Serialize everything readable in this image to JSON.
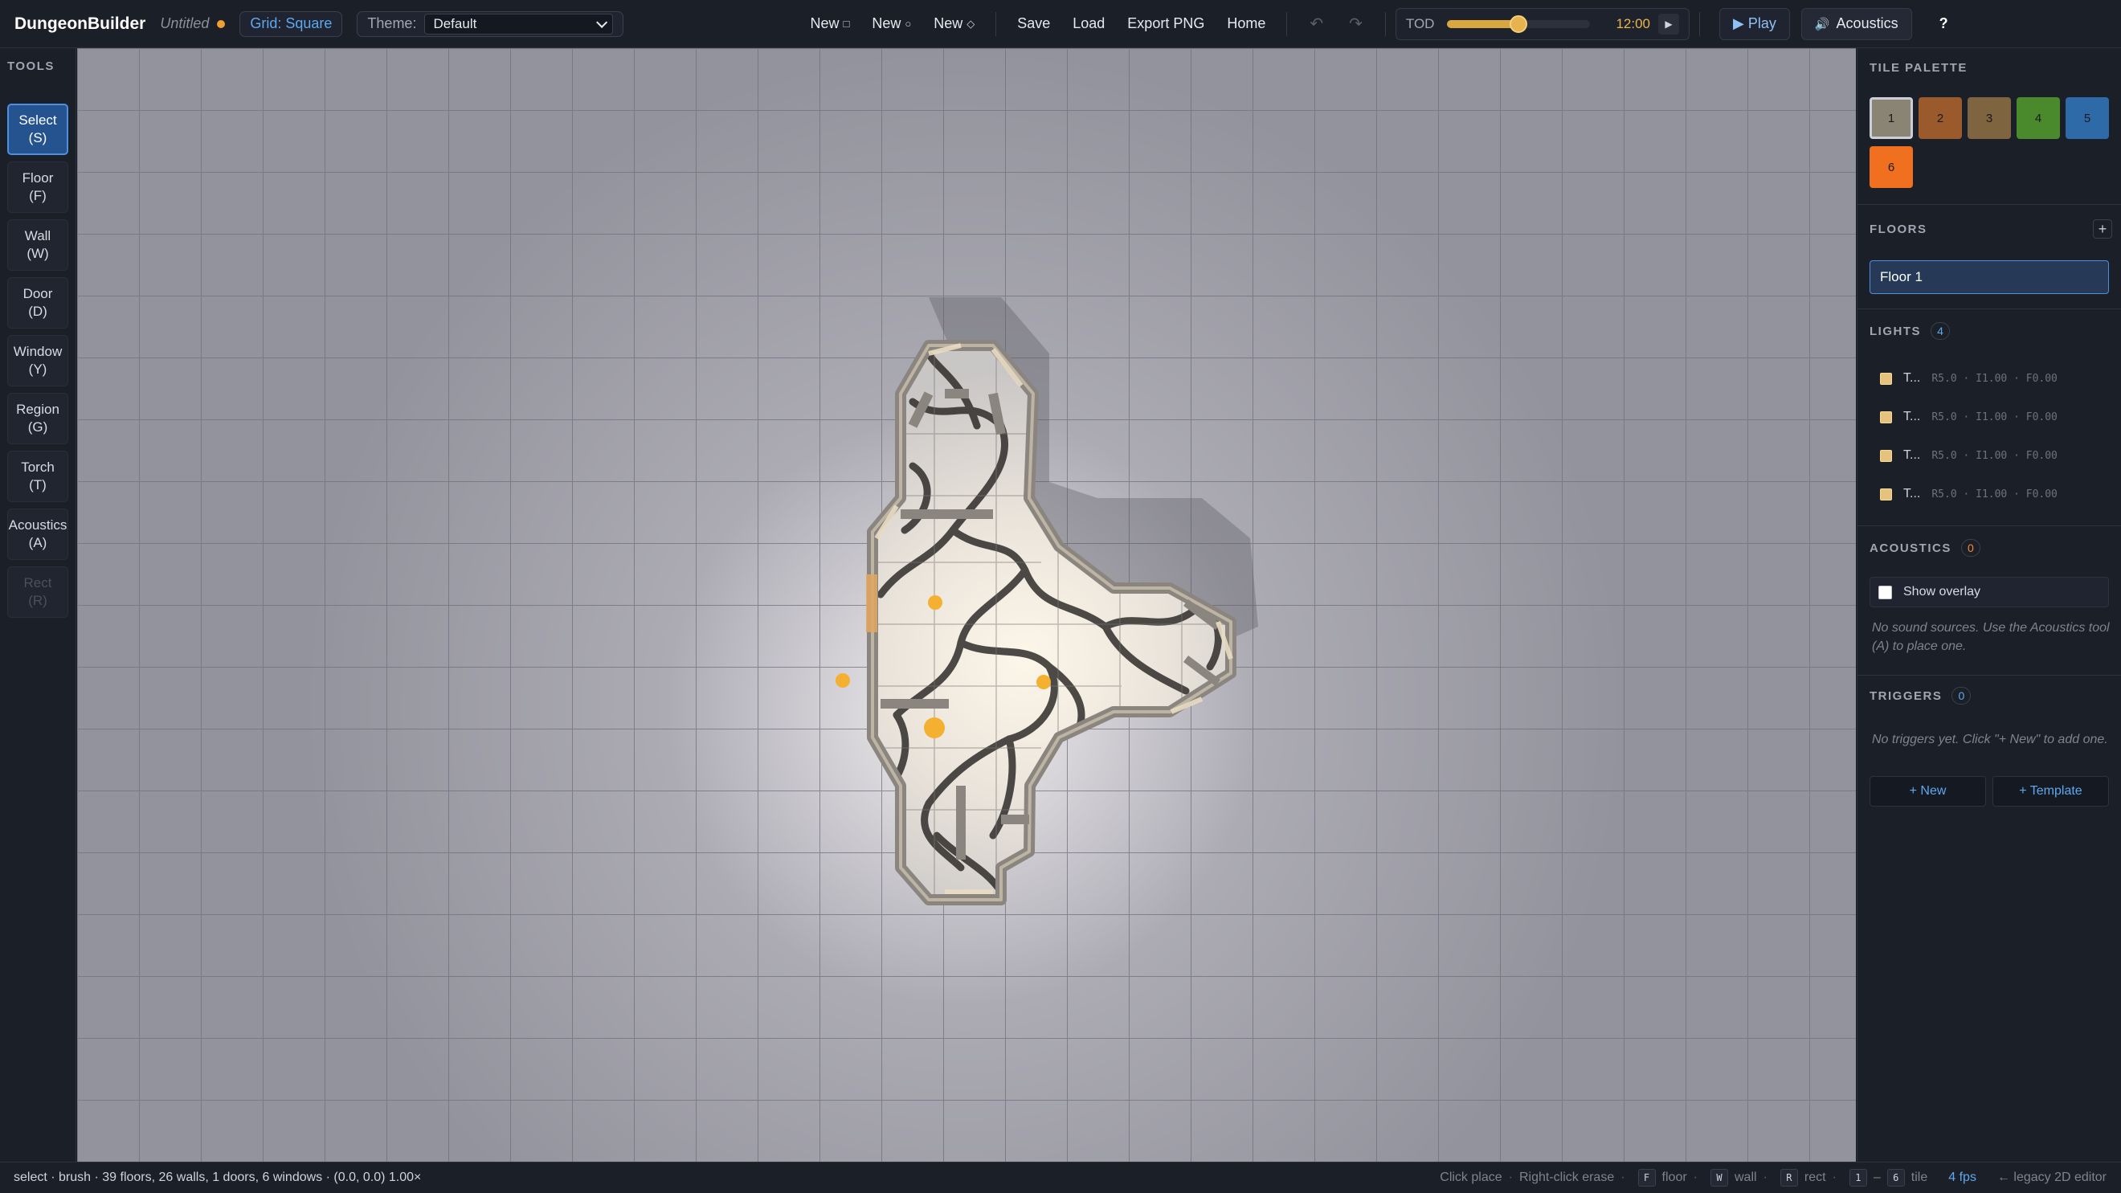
{
  "app": {
    "brand": "DungeonBuilder",
    "doc_name": "Untitled",
    "grid_label": "Grid: Square",
    "theme_label": "Theme:",
    "theme_value": "Default"
  },
  "toolbar": {
    "new_square": "New",
    "new_square_glyph": "□",
    "new_circle": "New",
    "new_circle_glyph": "○",
    "new_diamond": "New",
    "new_diamond_glyph": "◇",
    "save": "Save",
    "load": "Load",
    "export": "Export PNG",
    "home": "Home",
    "undo_glyph": "↶",
    "redo_glyph": "↷",
    "tod_label": "TOD",
    "tod_value": 0.5,
    "tod_time": "12:00",
    "tod_play_glyph": "▶",
    "play": "▶ Play",
    "acoustics_glyph": "🔊",
    "acoustics": "Acoustics",
    "help": "?"
  },
  "tools": {
    "title": "TOOLS",
    "items": [
      {
        "label": "Select",
        "key": "(S)"
      },
      {
        "label": "Floor",
        "key": "(F)"
      },
      {
        "label": "Wall",
        "key": "(W)"
      },
      {
        "label": "Door",
        "key": "(D)"
      },
      {
        "label": "Window",
        "key": "(Y)"
      },
      {
        "label": "Region",
        "key": "(G)"
      },
      {
        "label": "Torch",
        "key": "(T)"
      },
      {
        "label": "Acoustics",
        "key": "(A)"
      },
      {
        "label": "Rect",
        "key": "(R)"
      }
    ]
  },
  "panel": {
    "tile_palette": {
      "title": "TILE PALETTE",
      "swatches": [
        {
          "label": "1",
          "color": "#8a8475"
        },
        {
          "label": "2",
          "color": "#9a5a2c"
        },
        {
          "label": "3",
          "color": "#7f6440"
        },
        {
          "label": "4",
          "color": "#4a8a2c"
        },
        {
          "label": "5",
          "color": "#2e6aa8"
        },
        {
          "label": "6",
          "color": "#f07020"
        }
      ]
    },
    "floors": {
      "title": "FLOORS",
      "add": "+",
      "items": [
        "Floor 1"
      ]
    },
    "lights": {
      "title": "LIGHTS",
      "count": "4",
      "items": [
        {
          "name": "T...",
          "meta": "R5.0 · I1.00 · F0.00"
        },
        {
          "name": "T...",
          "meta": "R5.0 · I1.00 · F0.00"
        },
        {
          "name": "T...",
          "meta": "R5.0 · I1.00 · F0.00"
        },
        {
          "name": "T...",
          "meta": "R5.0 · I1.00 · F0.00"
        }
      ]
    },
    "acoustics": {
      "title": "ACOUSTICS",
      "count": "0",
      "overlay_label": "Show overlay",
      "hint": "No sound sources. Use the Acoustics tool (A) to place one."
    },
    "triggers": {
      "title": "TRIGGERS",
      "count": "0",
      "hint": "No triggers yet. Click \"+ New\" to add one.",
      "new_btn": "+ New",
      "template_btn": "+ Template"
    }
  },
  "statusbar": {
    "left": "select · brush · 39 floors, 26 walls, 1 doors, 6 windows · (0.0, 0.0) 1.00×",
    "click_place": "Click place",
    "right_click": "Right-click erase",
    "key_f": "F",
    "floor": "floor",
    "key_w": "W",
    "wall": "wall",
    "key_r": "R",
    "rect": "rect",
    "key_1": "1",
    "dash": "–",
    "key_6": "6",
    "tile": "tile",
    "fps": "4 fps",
    "legacy": "← legacy 2D editor"
  },
  "colors": {
    "accent": "#4d8fe0",
    "torch": "#f4b030",
    "grid_bg": "#9898a2"
  }
}
